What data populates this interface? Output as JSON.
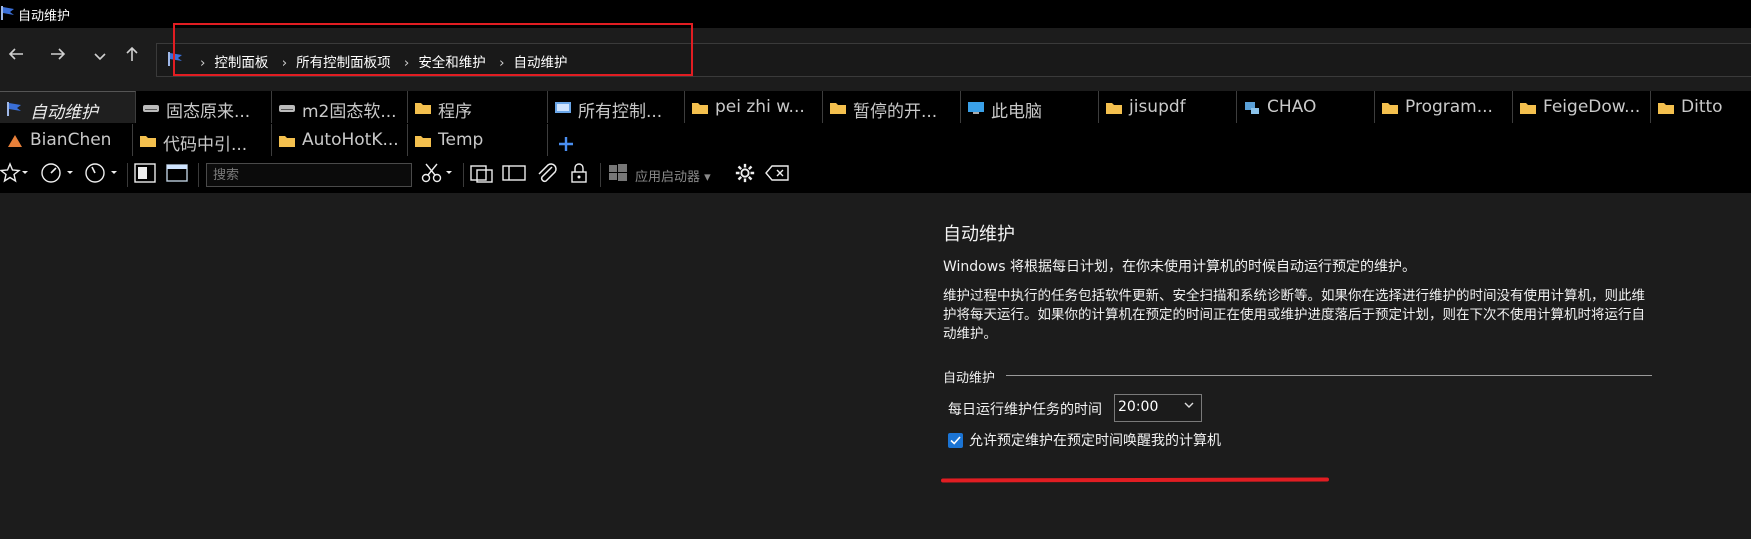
{
  "window": {
    "title": "自动维护",
    "icon": "control-panel-flag-icon"
  },
  "nav": {
    "back_icon": "arrow-left-icon",
    "forward_icon": "arrow-right-icon",
    "recent_icon": "chevron-down-icon",
    "up_icon": "arrow-up-icon",
    "breadcrumbs": [
      "控制面板",
      "所有控制面板项",
      "安全和维护",
      "自动维护"
    ]
  },
  "tabs": {
    "row1": [
      {
        "label": "自动维护",
        "icon": "control-panel-flag-icon",
        "active": true
      },
      {
        "label": "固态原来...",
        "icon": "drive-icon"
      },
      {
        "label": "m2固态软...",
        "icon": "drive-icon"
      },
      {
        "label": "程序",
        "icon": "folder-icon"
      },
      {
        "label": "所有控制...",
        "icon": "control-panel-icon"
      },
      {
        "label": "pei zhi w...",
        "icon": "folder-icon"
      },
      {
        "label": "暂停的开...",
        "icon": "folder-icon"
      },
      {
        "label": "此电脑",
        "icon": "computer-icon"
      },
      {
        "label": "jisupdf",
        "icon": "folder-icon"
      },
      {
        "label": "CHAO",
        "icon": "network-icon"
      },
      {
        "label": "Program...",
        "icon": "folder-icon"
      },
      {
        "label": "FeigeDow...",
        "icon": "folder-icon"
      },
      {
        "label": "Ditto",
        "icon": "folder-icon"
      }
    ],
    "row2": [
      {
        "label": "BianChen",
        "icon": "bianchen-icon"
      },
      {
        "label": "代码中引...",
        "icon": "folder-icon"
      },
      {
        "label": "AutoHotK...",
        "icon": "folder-icon"
      },
      {
        "label": "Temp",
        "icon": "folder-icon"
      }
    ],
    "add_icon": "plus-icon"
  },
  "toolbar": {
    "search_placeholder": "搜索",
    "app_launcher_label": "应用启动器"
  },
  "content": {
    "heading": "自动维护",
    "desc1": "Windows 将根据每日计划，在你未使用计算机的时候自动运行预定的维护。",
    "desc2": "维护过程中执行的任务包括软件更新、安全扫描和系统诊断等。如果你在选择进行维护的时间没有使用计算机，则此维护将每天运行。如果你的计算机在预定的时间正在使用或维护进度落后于预定计划，则在下次不使用计算机时将运行自动维护。",
    "group_label": "自动维护",
    "time_label": "每日运行维护任务的时间",
    "time_value": "20:00",
    "wake_label": "允许预定维护在预定时间唤醒我的计算机",
    "wake_checked": true
  },
  "colors": {
    "annotation_red": "#e11d22",
    "checkbox_blue": "#1b74d4",
    "background": "#1c1c1c"
  }
}
